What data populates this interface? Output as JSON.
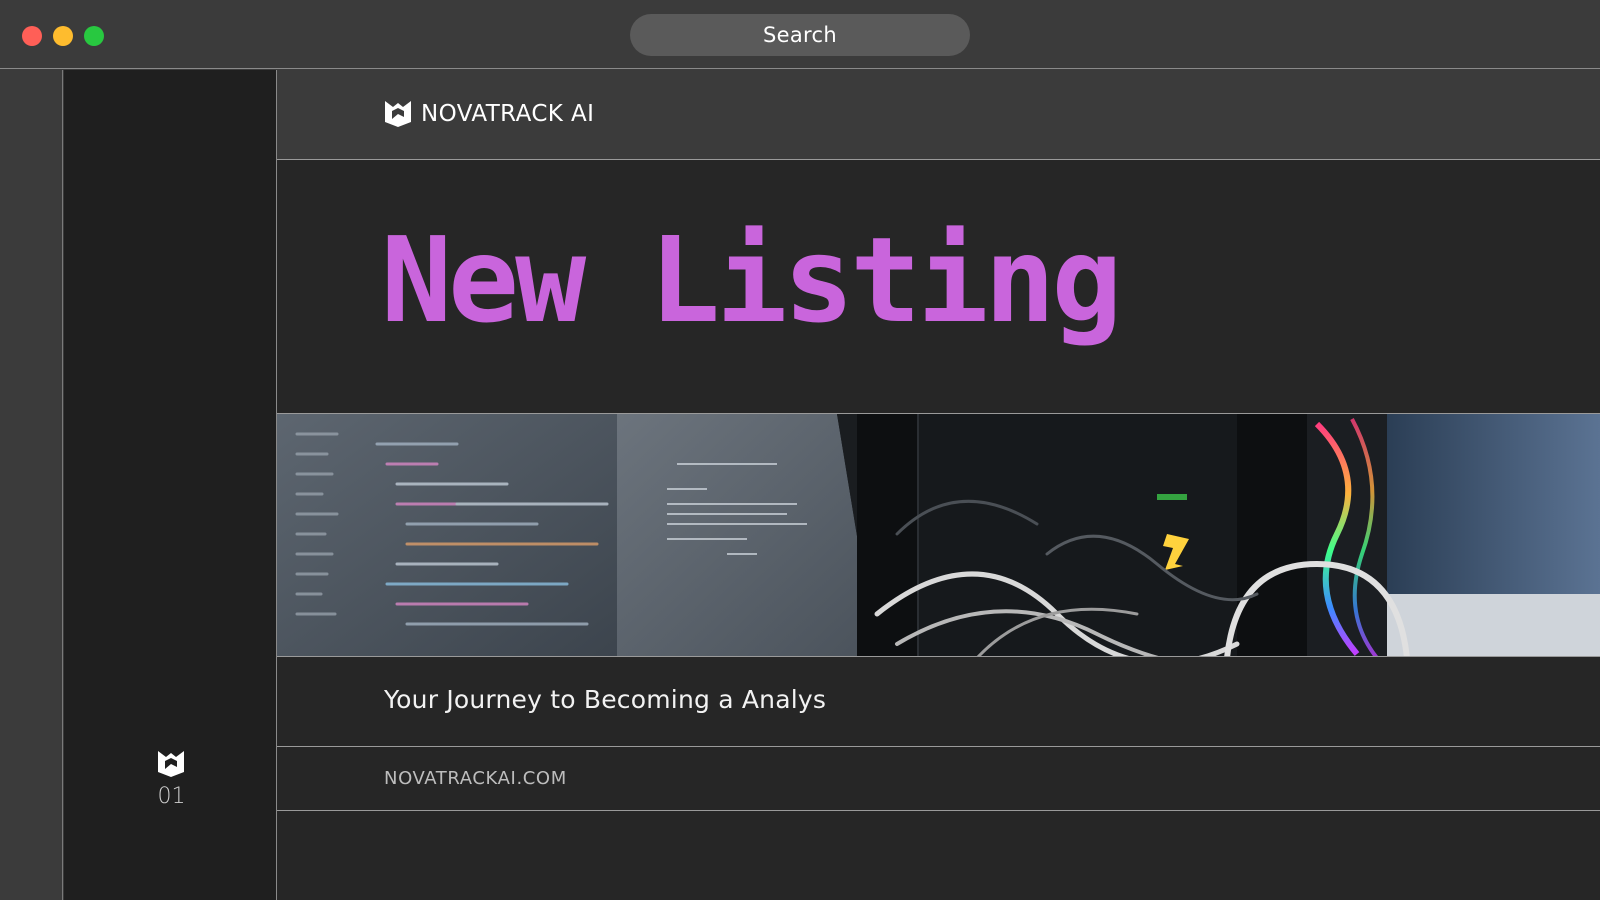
{
  "window": {
    "search_label": "Search"
  },
  "brand": {
    "name": "NOVATRACK AI",
    "logo_icon": "novatrack-logo-icon"
  },
  "hero": {
    "title": "New Listing",
    "title_color": "#c965dc"
  },
  "banner": {
    "image": "banner-photo-laptop-code-and-pc-cables"
  },
  "subtitle": "Your Journey to Becoming a Analys",
  "footer": {
    "url": "NOVATRACKAI.COM"
  },
  "sidebar": {
    "page_number": "01",
    "logo_icon": "novatrack-logo-icon"
  },
  "colors": {
    "titlebar": "#3b3b3b",
    "sidebar": "#1f1f1f",
    "content": "#262626",
    "accent": "#c965dc"
  }
}
